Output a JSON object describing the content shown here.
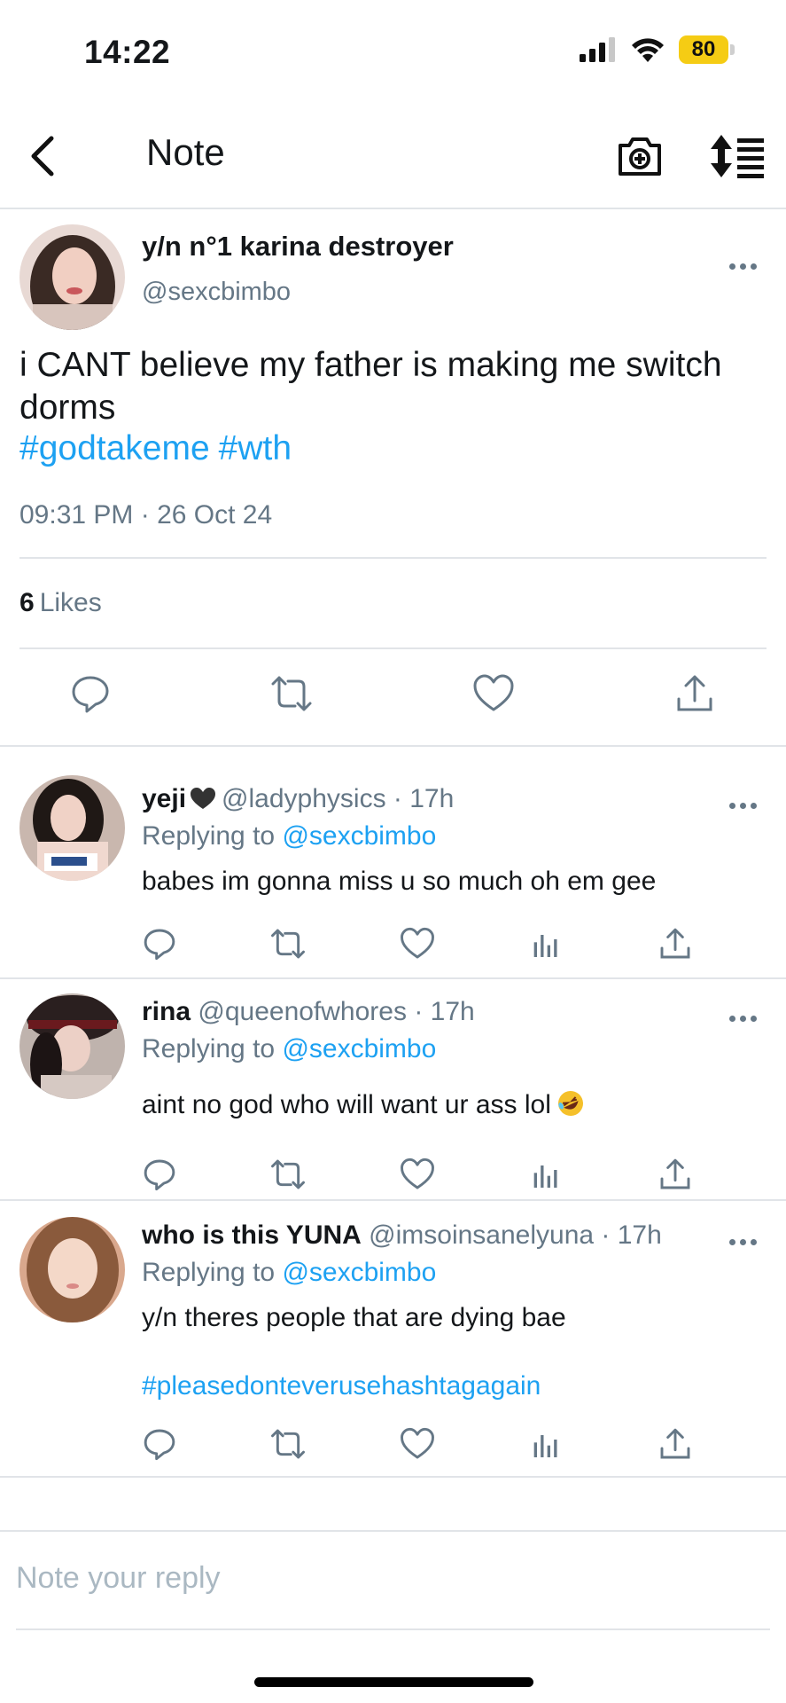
{
  "status_bar": {
    "time": "14:22",
    "battery": "80",
    "icons": [
      "signal-icon",
      "wifi-icon",
      "battery-icon"
    ],
    "battery_color": "#f5cc14"
  },
  "nav": {
    "title": "Note",
    "icons": [
      "back-chevron-icon",
      "camera-add-icon",
      "sort-icon"
    ]
  },
  "main_post": {
    "display_name": "y/n n°1 karina destroyer",
    "handle": "@sexcbimbo",
    "text": "i CANT believe my father is making me switch dorms",
    "hashtags": [
      "#godtakeme",
      "#wth"
    ],
    "timestamp": "09:31 PM · 26 Oct 24",
    "likes_count": "6",
    "likes_label": "Likes",
    "actions": [
      "reply-icon",
      "retweet-icon",
      "like-icon",
      "share-icon"
    ]
  },
  "replies": [
    {
      "name": "yeji",
      "handle": "@ladyphysics",
      "age": "· 17h",
      "replying_prefix": "Replying to",
      "replying_to": "@sexcbimbo",
      "text": "babes im gonna miss u so much oh em gee"
    },
    {
      "name": "rina",
      "handle": "@queenofwhores",
      "age": "· 17h",
      "replying_prefix": "Replying to",
      "replying_to": "@sexcbimbo",
      "text": "aint no god who will want ur ass lol",
      "emoji": "rolling-on-floor-laughing-emoji"
    },
    {
      "name": "who is this YUNA",
      "handle": "@imsoinsanelyuna",
      "age": "· 17h",
      "replying_prefix": "Replying to",
      "replying_to": "@sexcbimbo",
      "text": "y/n theres people that are dying bae",
      "hashtag": "#pleasedonteverusehashtagagain"
    }
  ],
  "reply_actions": [
    "reply-icon",
    "retweet-icon",
    "like-icon",
    "analytics-icon",
    "share-icon"
  ],
  "reply_box": {
    "placeholder": "Note your reply"
  },
  "colors": {
    "accent": "#1da1f2",
    "secondary_text": "#657786",
    "divider": "#e1e4e8"
  }
}
